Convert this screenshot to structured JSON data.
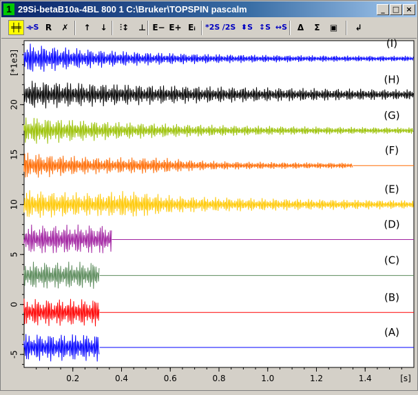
{
  "window": {
    "number": "1",
    "title": "29Si-betaB10a-4BL  800  1 C:\\Bruker\\TOPSPIN  pascalm",
    "controls": [
      "_",
      "□",
      "×"
    ]
  },
  "toolbar": {
    "tools": [
      {
        "name": "display-mode-tool",
        "label": "╪╪",
        "active": true
      },
      {
        "name": "scale-dataset-tool",
        "label": "⟛S"
      },
      {
        "name": "reset-tool",
        "label": "R"
      },
      {
        "name": "remove-tool",
        "label": "✗"
      },
      {
        "name": "move-up-tool",
        "label": "↑"
      },
      {
        "name": "move-down-tool",
        "label": "↓"
      },
      {
        "name": "stack-tool",
        "label": "⫶↕"
      },
      {
        "name": "superimpose-tool",
        "label": "⊥"
      },
      {
        "name": "expand-minus-tool",
        "label": "E−"
      },
      {
        "name": "expand-plus-tool",
        "label": "E+"
      },
      {
        "name": "expand-i-tool",
        "label": "Eᵢ"
      },
      {
        "name": "scale-up-tool",
        "label": "*2S"
      },
      {
        "name": "scale-down-tool",
        "label": "/2S"
      },
      {
        "name": "shift-vertical-tool",
        "label": "⬍S"
      },
      {
        "name": "scale-vertical-tool",
        "label": "↕S"
      },
      {
        "name": "scale-horizontal-tool",
        "label": "↔S"
      },
      {
        "name": "difference-tool",
        "label": "Δ"
      },
      {
        "name": "sum-tool",
        "label": "Σ"
      },
      {
        "name": "save-tool",
        "label": "▣"
      },
      {
        "name": "return-tool",
        "label": "↲"
      }
    ]
  },
  "chart_data": {
    "type": "line",
    "title": "",
    "xlabel": "[s]",
    "ylabel": "[*1e3]",
    "xlim": [
      0.0,
      1.6
    ],
    "ylim": [
      -6.3,
      26.4
    ],
    "x_ticks": [
      "0.2",
      "0.4",
      "0.6",
      "0.8",
      "1.0",
      "1.2",
      "1.4"
    ],
    "y_ticks": [
      "-5",
      "0",
      "5",
      "10",
      "15",
      "20"
    ],
    "grid": false,
    "series": [
      {
        "name": "(A)",
        "color": "#0000ff",
        "baseline": -4.3,
        "amplitude": 1.4,
        "end_time": 0.31,
        "decay": 0.0
      },
      {
        "name": "(B)",
        "color": "#ff0000",
        "baseline": -0.8,
        "amplitude": 1.4,
        "end_time": 0.31,
        "decay": 0.0
      },
      {
        "name": "(C)",
        "color": "#5a8a5a",
        "baseline": 2.9,
        "amplitude": 1.4,
        "end_time": 0.31,
        "decay": 0.0
      },
      {
        "name": "(D)",
        "color": "#a020a0",
        "baseline": 6.5,
        "amplitude": 1.5,
        "end_time": 0.36,
        "decay": 0.0
      },
      {
        "name": "(E)",
        "color": "#ffc800",
        "baseline": 10.0,
        "amplitude": 1.5,
        "end_time": 1.6,
        "decay": 1.1
      },
      {
        "name": "(F)",
        "color": "#ff6a00",
        "baseline": 13.9,
        "amplitude": 1.4,
        "end_time": 1.35,
        "decay": 2.0
      },
      {
        "name": "(G)",
        "color": "#99c000",
        "baseline": 17.4,
        "amplitude": 1.5,
        "end_time": 1.6,
        "decay": 1.6
      },
      {
        "name": "(H)",
        "color": "#000000",
        "baseline": 21.0,
        "amplitude": 1.5,
        "end_time": 1.6,
        "decay": 0.9
      },
      {
        "name": "(I)",
        "color": "#0000ff",
        "baseline": 24.6,
        "amplitude": 1.6,
        "end_time": 1.6,
        "decay": 2.2
      }
    ]
  }
}
